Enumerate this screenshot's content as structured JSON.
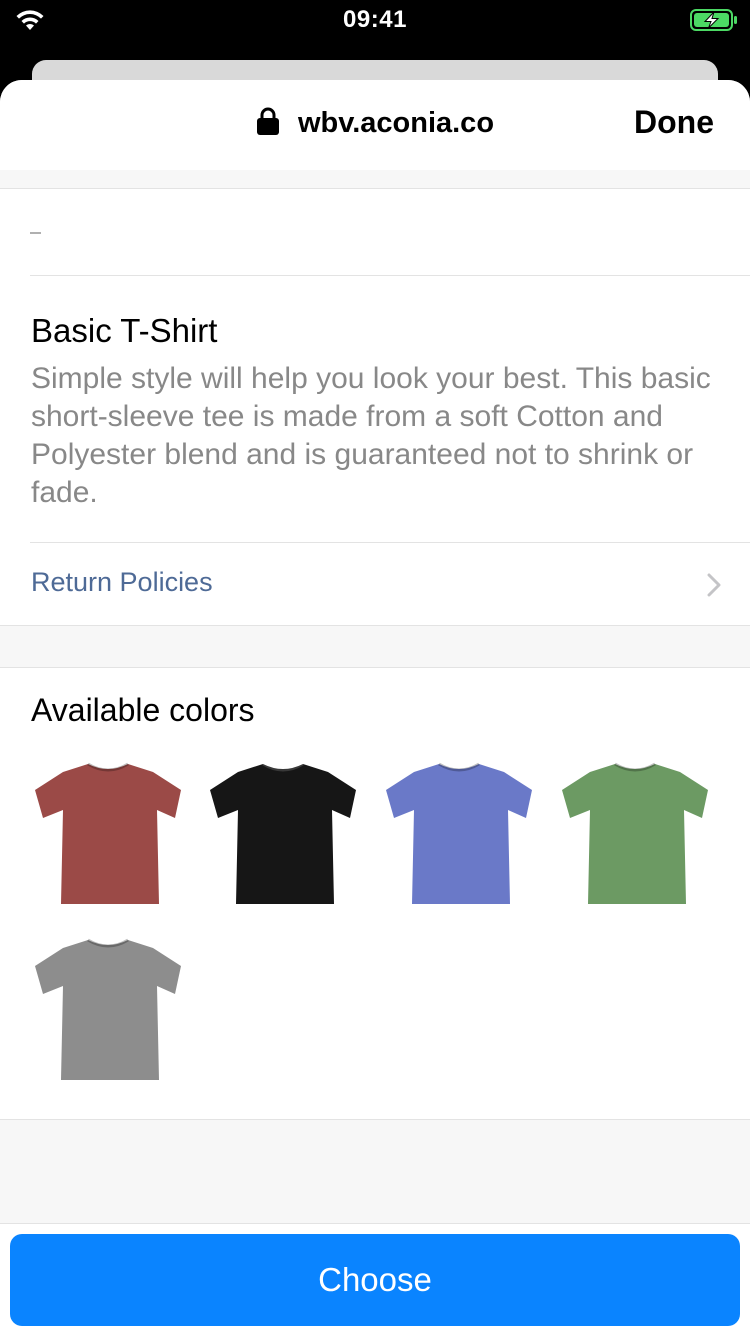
{
  "status_bar": {
    "time": "09:41",
    "wifi_icon": "wifi-icon",
    "battery_icon": "battery-charging-icon"
  },
  "browser": {
    "url": "wbv.aconia.co",
    "lock_icon": "lock-icon",
    "done_label": "Done"
  },
  "placeholder_dash": "–",
  "product": {
    "title": "Basic T-Shirt",
    "description": "Simple style will help you look your best. This basic short-sleeve tee is made from a soft Cotton and Polyester blend and is guaranteed not to shrink or fade."
  },
  "return_policies": {
    "label": "Return Policies",
    "icon": "chevron-right-icon"
  },
  "colors_section": {
    "title": "Available colors",
    "colors": [
      {
        "name": "red",
        "hex": "#9b4a47"
      },
      {
        "name": "black",
        "hex": "#161616"
      },
      {
        "name": "blue",
        "hex": "#6a79c8"
      },
      {
        "name": "green",
        "hex": "#6c9a63"
      },
      {
        "name": "gray",
        "hex": "#8d8d8d"
      }
    ]
  },
  "action": {
    "choose_label": "Choose"
  },
  "theme": {
    "accent": "#0a84ff",
    "link": "#4e6a96",
    "battery": "#4cd964"
  }
}
